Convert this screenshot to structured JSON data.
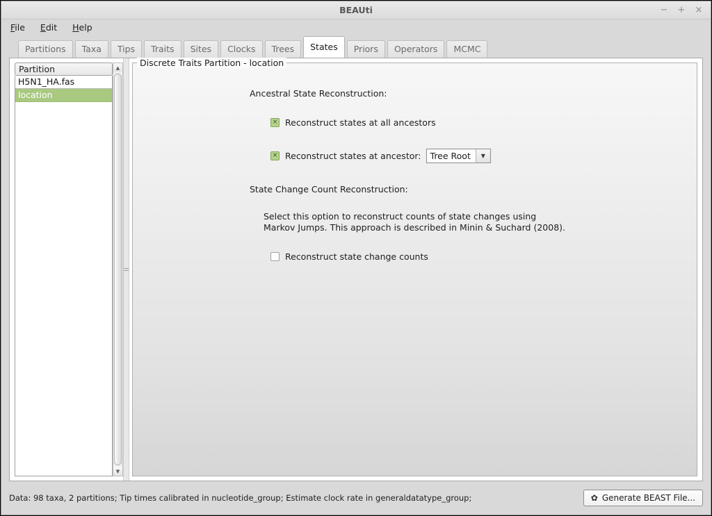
{
  "window": {
    "title": "BEAUti",
    "controls": {
      "minimize": "−",
      "maximize": "+",
      "close": "×"
    }
  },
  "menubar": {
    "items": [
      {
        "mnemonic": "F",
        "rest": "ile"
      },
      {
        "mnemonic": "E",
        "rest": "dit"
      },
      {
        "mnemonic": "H",
        "rest": "elp"
      }
    ]
  },
  "tabs": {
    "active": "States",
    "items": [
      "Partitions",
      "Taxa",
      "Tips",
      "Traits",
      "Sites",
      "Clocks",
      "Trees",
      "States",
      "Priors",
      "Operators",
      "MCMC"
    ]
  },
  "partition_panel": {
    "header": "Partition",
    "rows": [
      {
        "label": "H5N1_HA.fas",
        "selected": false
      },
      {
        "label": "location",
        "selected": true
      }
    ],
    "scrollbar": {
      "up_arrow": "▲",
      "down_arrow": "▼"
    }
  },
  "states_panel": {
    "group_title": "Discrete Traits Partition - location",
    "ancestral_heading": "Ancestral State Reconstruction:",
    "check_all_ancestors": {
      "label": "Reconstruct states at all ancestors",
      "checked": true,
      "mark": "×"
    },
    "check_at_ancestor": {
      "label": "Reconstruct states at ancestor:",
      "checked": true,
      "mark": "×"
    },
    "ancestor_combo": {
      "value": "Tree Root",
      "arrow": "▼"
    },
    "state_change_heading": "State Change Count Reconstruction:",
    "description_line1": "Select this option to reconstruct counts of state changes using",
    "description_line2": "Markov Jumps. This approach is described in Minin & Suchard (2008).",
    "check_state_change": {
      "label": "Reconstruct state change counts",
      "checked": false,
      "mark": ""
    }
  },
  "statusbar": {
    "text": "Data: 98 taxa, 2 partitions; Tip times calibrated in nucleotide_group; Estimate clock rate in generaldatatype_group;",
    "generate_button": {
      "icon": "✿",
      "label": "Generate BEAST File..."
    }
  },
  "colors": {
    "selection_green": "#a8c97f",
    "checkbox_green": "#b5d38c",
    "window_gray": "#d9d9d9"
  }
}
